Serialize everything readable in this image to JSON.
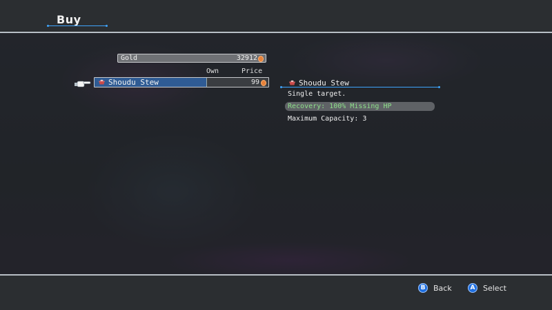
{
  "header": {
    "title": "Buy"
  },
  "shop": {
    "gold_label": "Gold",
    "gold_value": "32912",
    "columns": {
      "own": "Own",
      "price": "Price"
    },
    "items": [
      {
        "name": "Shoudu Stew",
        "own": "",
        "price": "99",
        "selected": true
      }
    ]
  },
  "detail": {
    "name": "Shoudu Stew",
    "description": "Single target.",
    "recovery": "Recovery: 100% Missing HP",
    "capacity": "Maximum Capacity: 3"
  },
  "footer": {
    "back": {
      "button": "B",
      "label": "Back"
    },
    "select": {
      "button": "A",
      "label": "Select"
    }
  },
  "colors": {
    "accent": "#3fa6ff",
    "selection": "#2f5b94",
    "recovery_text": "#8de08a",
    "coin": "#e7823a"
  },
  "icons": {
    "item": "stew-pot-icon",
    "pointer": "hand-pointer-icon",
    "currency": "coin-icon"
  }
}
